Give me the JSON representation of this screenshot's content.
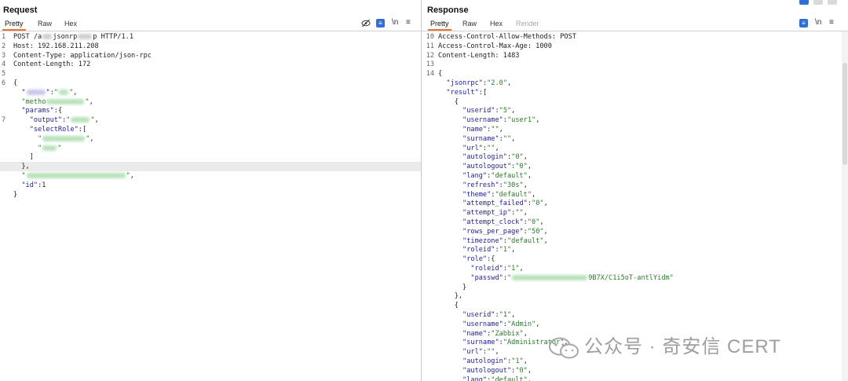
{
  "request": {
    "title": "Request",
    "tabs": [
      "Pretty",
      "Raw",
      "Hex"
    ],
    "lines": [
      {
        "n": "1",
        "t": "POST /a  jsonrp   p HTTP/1.1"
      },
      {
        "n": "2",
        "t": "Host: 192.168.211.208"
      },
      {
        "n": "3",
        "t": "Content-Type: application/json-rpc"
      },
      {
        "n": "4",
        "t": "Content-Length: 172"
      },
      {
        "n": "5",
        "t": ""
      },
      {
        "n": "6",
        "t": "{"
      },
      {
        "n": "",
        "t": "  \"    \":\"  \","
      },
      {
        "n": "",
        "t": "  \"metho        \","
      },
      {
        "n": "",
        "t": "  \"params\":{"
      },
      {
        "n": "7",
        "t": "    \"output\":\"    \","
      },
      {
        "n": "",
        "t": "    \"selectRole\":["
      },
      {
        "n": "",
        "t": "      \"         \","
      },
      {
        "n": "",
        "t": "      \"   \""
      },
      {
        "n": "",
        "t": "    ]"
      },
      {
        "n": "",
        "t": "  },"
      },
      {
        "n": "",
        "t": "  \"                     \","
      },
      {
        "n": "",
        "t": "  \"id\":1"
      },
      {
        "n": "",
        "t": "}"
      }
    ]
  },
  "response": {
    "title": "Response",
    "tabs": [
      "Pretty",
      "Raw",
      "Hex",
      "Render"
    ],
    "lines": [
      {
        "n": "10",
        "t": "Access-Control-Allow-Methods: POST"
      },
      {
        "n": "11",
        "t": "Access-Control-Max-Age: 1000"
      },
      {
        "n": "12",
        "t": "Content-Length: 1483"
      },
      {
        "n": "13",
        "t": ""
      },
      {
        "n": "14",
        "t": "{"
      },
      {
        "n": "",
        "t": "  \"jsonrpc\":\"2.0\","
      },
      {
        "n": "",
        "t": "  \"result\":["
      },
      {
        "n": "",
        "t": "    {"
      },
      {
        "n": "",
        "t": "      \"userid\":\"5\","
      },
      {
        "n": "",
        "t": "      \"username\":\"user1\","
      },
      {
        "n": "",
        "t": "      \"name\":\"\","
      },
      {
        "n": "",
        "t": "      \"surname\":\"\","
      },
      {
        "n": "",
        "t": "      \"url\":\"\","
      },
      {
        "n": "",
        "t": "      \"autologin\":\"0\","
      },
      {
        "n": "",
        "t": "      \"autologout\":\"0\","
      },
      {
        "n": "",
        "t": "      \"lang\":\"default\","
      },
      {
        "n": "",
        "t": "      \"refresh\":\"30s\","
      },
      {
        "n": "",
        "t": "      \"theme\":\"default\","
      },
      {
        "n": "",
        "t": "      \"attempt_failed\":\"0\","
      },
      {
        "n": "",
        "t": "      \"attempt_ip\":\"\","
      },
      {
        "n": "",
        "t": "      \"attempt_clock\":\"0\","
      },
      {
        "n": "",
        "t": "      \"rows_per_page\":\"50\","
      },
      {
        "n": "",
        "t": "      \"timezone\":\"default\","
      },
      {
        "n": "",
        "t": "      \"roleid\":\"1\","
      },
      {
        "n": "",
        "t": "      \"role\":{"
      },
      {
        "n": "",
        "t": "        \"roleid\":\"1\","
      },
      {
        "n": "",
        "t": "        \"passwd\":\"                9B7X/C1i5oT-antlYidm\""
      },
      {
        "n": "",
        "t": "      }"
      },
      {
        "n": "",
        "t": "    },"
      },
      {
        "n": "",
        "t": "    {"
      },
      {
        "n": "",
        "t": "      \"userid\":\"1\","
      },
      {
        "n": "",
        "t": "      \"username\":\"Admin\","
      },
      {
        "n": "",
        "t": "      \"name\":\"Zabbix\","
      },
      {
        "n": "",
        "t": "      \"surname\":\"Administrator\","
      },
      {
        "n": "",
        "t": "      \"url\":\"\","
      },
      {
        "n": "",
        "t": "      \"autologin\":\"1\","
      },
      {
        "n": "",
        "t": "      \"autologout\":\"0\","
      },
      {
        "n": "",
        "t": "      \"lang\":\"default\","
      }
    ]
  },
  "toolbar": {
    "newline_label": "\\n",
    "menu_label": "≡"
  },
  "watermark": {
    "text": "公众号 · 奇安信 CERT"
  },
  "colors": {
    "accent_tab": "#e8742f",
    "icon_blue": "#2f6fd6",
    "json_key": "#1e1e9b",
    "json_string": "#2a7a2a"
  }
}
